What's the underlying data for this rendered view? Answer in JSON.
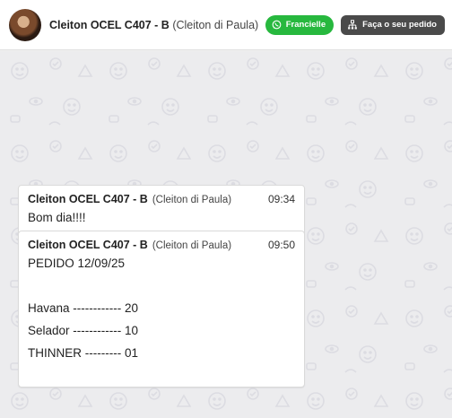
{
  "header": {
    "name": "Cleiton OCEL C407 - B",
    "subname": "(Cleiton di Paula)",
    "whatsapp_label": "Francielle",
    "order_label": "Faça o seu pedido"
  },
  "colors": {
    "whatsapp_green": "#27b83e",
    "order_button": "#4a4a4a",
    "chat_background": "#ececee"
  },
  "messages": [
    {
      "sender": "Cleiton OCEL C407 - B",
      "subname": "(Cleiton di Paula)",
      "time": "09:34",
      "lines": [
        "Bom dia!!!!"
      ]
    },
    {
      "sender": "Cleiton OCEL C407 - B",
      "subname": "(Cleiton di Paula)",
      "time": "09:50",
      "lines": [
        "PEDIDO 12/09/25",
        "",
        "Havana ------------ 20",
        "Selador ------------ 10",
        "THINNER --------- 01"
      ]
    }
  ]
}
